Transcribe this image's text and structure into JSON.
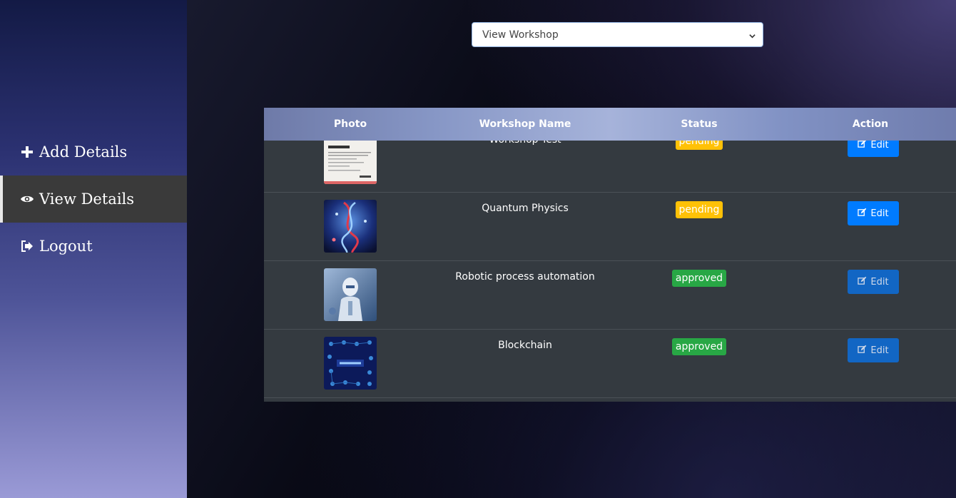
{
  "sidebar": {
    "items": [
      {
        "label": "Add Details",
        "icon": "plus-icon",
        "active": false
      },
      {
        "label": "View Details",
        "icon": "eye-icon",
        "active": true
      },
      {
        "label": "Logout",
        "icon": "logout-icon",
        "active": false
      }
    ]
  },
  "select": {
    "value": "View Workshop"
  },
  "table": {
    "headers": [
      "Photo",
      "Workshop Name",
      "Status",
      "Action"
    ],
    "rows": [
      {
        "name": "Workshop Test",
        "status": "pending",
        "action": "Edit"
      },
      {
        "name": "Quantum Physics",
        "status": "pending",
        "action": "Edit"
      },
      {
        "name": "Robotic process automation",
        "status": "approved",
        "action": "Edit"
      },
      {
        "name": "Blockchain",
        "status": "approved",
        "action": "Edit"
      }
    ]
  },
  "colors": {
    "pending": "#ffc107",
    "approved": "#28a745",
    "edit": "#007bff",
    "table_bg": "#343a40"
  }
}
